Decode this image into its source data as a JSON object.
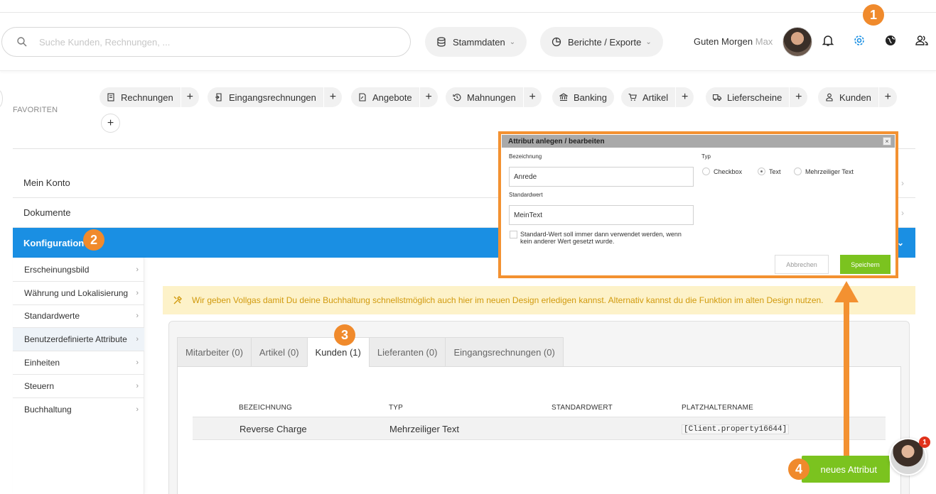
{
  "header": {
    "search_placeholder": "Suche Kunden, Rechnungen, ...",
    "menu_stammdaten": "Stammdaten",
    "menu_berichte": "Berichte / Exporte",
    "greeting": "Guten Morgen",
    "user_name": "Max"
  },
  "steps": {
    "one": "1",
    "two": "2",
    "three": "3",
    "four": "4"
  },
  "favorites": {
    "label": "FAVORITEN",
    "items": [
      {
        "label": "Rechnungen",
        "icon": "invoice-icon"
      },
      {
        "label": "Eingangsrechnungen",
        "icon": "incoming-invoice-icon"
      },
      {
        "label": "Angebote",
        "icon": "offer-icon"
      },
      {
        "label": "Mahnungen",
        "icon": "history-icon"
      },
      {
        "label": "Banking",
        "icon": "bank-icon"
      },
      {
        "label": "Artikel",
        "icon": "cart-icon"
      },
      {
        "label": "Lieferscheine",
        "icon": "truck-icon"
      },
      {
        "label": "Kunden",
        "icon": "user-icon"
      }
    ],
    "plus": "+"
  },
  "accordion": {
    "mein_konto": "Mein Konto",
    "dokumente": "Dokumente",
    "konfiguration": "Konfiguration"
  },
  "sidebar": {
    "items": [
      {
        "label": "Erscheinungsbild"
      },
      {
        "label": "Währung und Lokalisierung"
      },
      {
        "label": "Standardwerte"
      },
      {
        "label": "Benutzerdefinierte Attribute"
      },
      {
        "label": "Einheiten"
      },
      {
        "label": "Steuern"
      },
      {
        "label": "Buchhaltung"
      }
    ]
  },
  "notice": "Wir geben Vollgas damit Du deine Buchhaltung schnellstmöglich auch hier im neuen Design erledigen kannst. Alternativ kannst du die Funktion im alten Design nutzen.",
  "tabs": [
    {
      "label": "Mitarbeiter (0)"
    },
    {
      "label": "Artikel (0)"
    },
    {
      "label": "Kunden (1)"
    },
    {
      "label": "Lieferanten (0)"
    },
    {
      "label": "Eingangsrechnungen (0)"
    }
  ],
  "table": {
    "headers": [
      "BEZEICHNUNG",
      "TYP",
      "STANDARDWERT",
      "PLATZHALTERNAME"
    ],
    "rows": [
      {
        "bezeichnung": "Reverse Charge",
        "typ": "Mehrzeiliger Text",
        "standardwert": "",
        "platzhalter": "[Client.property16644]"
      }
    ]
  },
  "new_attribute_button": "neues Attribut",
  "chat_badge": "1",
  "dialog": {
    "title": "Attribut anlegen / bearbeiten",
    "close": "×",
    "bezeichnung_label": "Bezeichnung",
    "bezeichnung_value": "Anrede",
    "standardwert_label": "Standardwert",
    "standardwert_value": "MeinText",
    "typ_label": "Typ",
    "typ_options": [
      "Checkbox",
      "Text",
      "Mehrzeiliger Text"
    ],
    "typ_selected": "Text",
    "checkbox_text": "Standard-Wert soll immer dann verwendet werden, wenn kein anderer Wert gesetzt wurde.",
    "cancel": "Abbrechen",
    "save": "Speichern"
  },
  "colors": {
    "accent_blue": "#1a8fe3",
    "orange": "#f39131",
    "green": "#7bc31f",
    "notice_bg": "#fdf2c9",
    "notice_text": "#d19a0d"
  }
}
